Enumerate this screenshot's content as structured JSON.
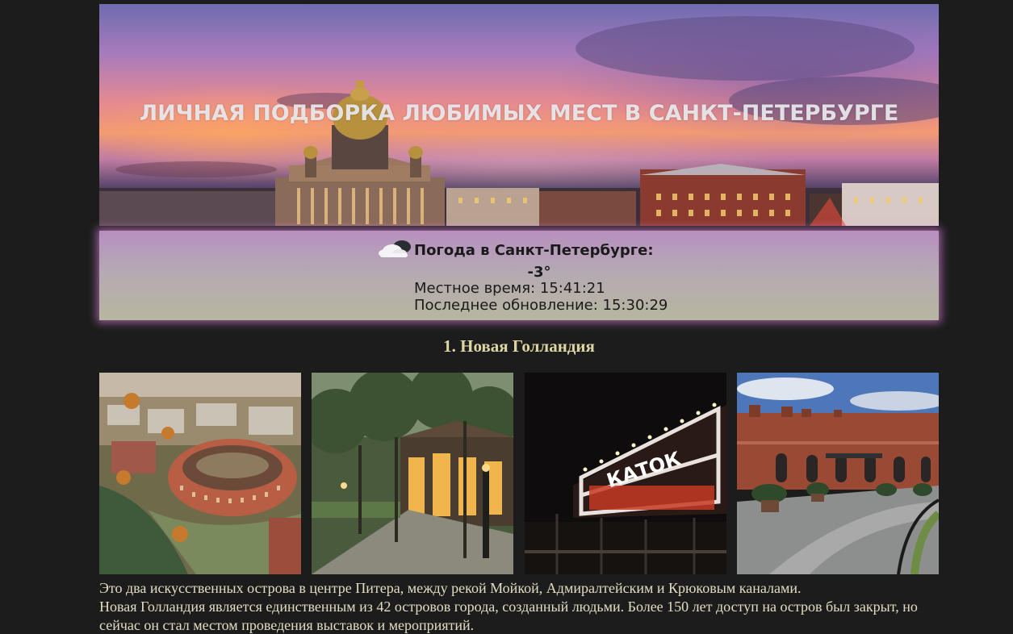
{
  "hero": {
    "title": "ЛИЧНАЯ ПОДБОРКА ЛЮБИМЫХ МЕСТ В САНКТ-ПЕТЕРБУРГЕ",
    "image": "saint-isaacs-cathedral-sunset-panorama"
  },
  "weather": {
    "icon": "cloud-icon",
    "title": "Погода в Санкт-Петербурге:",
    "temperature": "-3°",
    "local_time": "Местное время: 15:41:21",
    "last_update": "Последнее обновление: 15:30:29"
  },
  "places": [
    {
      "title": "1. Новая Голландия",
      "photos": [
        "new-holland-aerial-photo",
        "new-holland-park-evening-photo",
        "new-holland-katok-night-photo",
        "new-holland-brick-buildings-photo"
      ],
      "description_lines": [
        "Это два искусственных острова в центре Питера, между рекой Мойкой, Адмиралтейским и Крюковым каналами.",
        "Новая Голландия является единственным из 42 островов города, созданный людьми. Более 150 лет доступ на остров был закрыт, но сейчас он стал местом проведения выставок и мероприятий."
      ],
      "sign_text": "КАТОК"
    }
  ],
  "colors": {
    "background": "#1c1c1c",
    "title_text": "#ddd6a3",
    "body_text": "#e2dcc2",
    "weather_glow": "#ff96ff"
  }
}
